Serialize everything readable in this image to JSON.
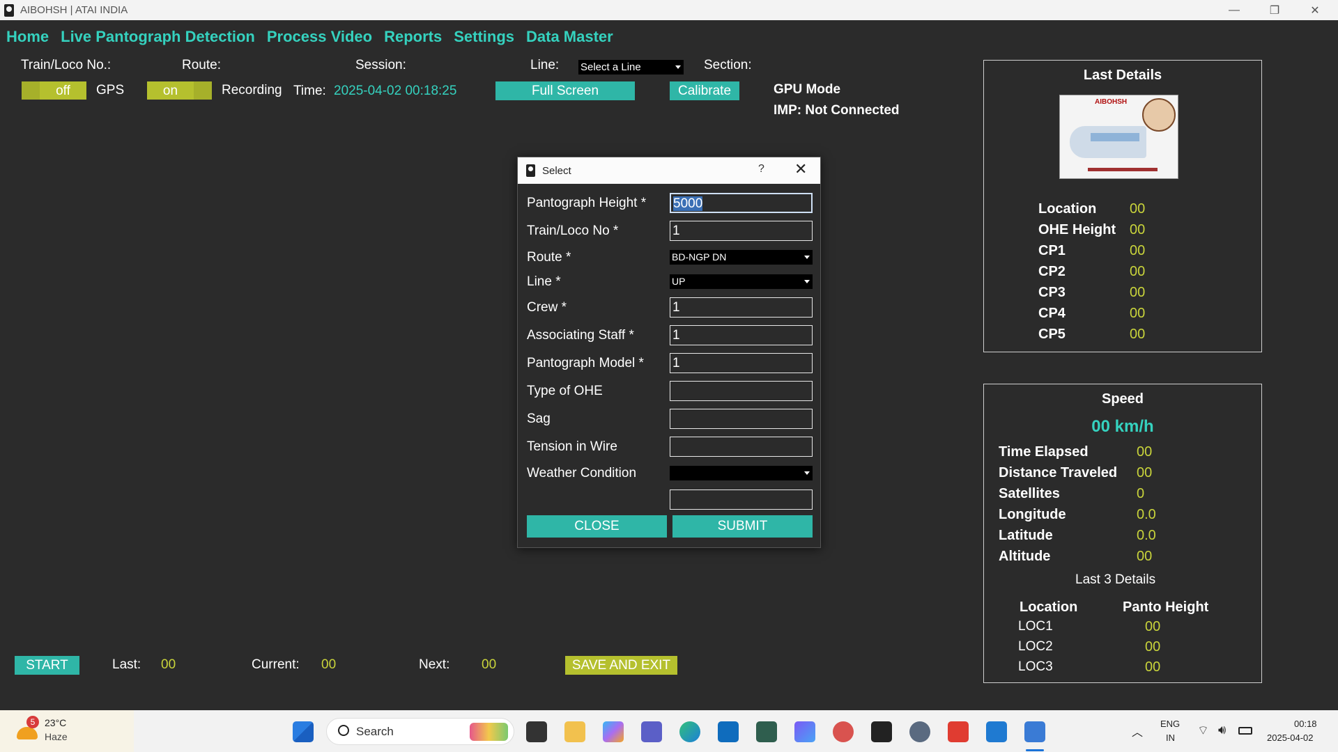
{
  "window": {
    "title": "AIBOHSH | ATAI INDIA",
    "minimize": "—",
    "restore": "❐",
    "close": "✕"
  },
  "menu": [
    "Home",
    "Live Pantograph Detection",
    "Process Video",
    "Reports",
    "Settings",
    "Data Master"
  ],
  "header": {
    "train_loco_label": "Train/Loco No.:",
    "route_label": "Route:",
    "session_label": "Session:",
    "line_label": "Line:",
    "line_select": "Select a Line",
    "section_label": "Section:",
    "gps_toggle": "off",
    "gps_label": "GPS",
    "recording_toggle": "on",
    "recording_label": "Recording",
    "time_label": "Time:",
    "time_value": "2025-04-02 00:18:25",
    "fullscreen_button": "Full Screen",
    "calibrate_button": "Calibrate",
    "gpu_mode": "GPU Mode",
    "imp_status": "IMP: Not Connected"
  },
  "last_details": {
    "title": "Last Details",
    "logo_text": "AIBOHSH",
    "rows": [
      {
        "label": "Location",
        "value": "00"
      },
      {
        "label": "OHE Height",
        "value": "00"
      },
      {
        "label": "CP1",
        "value": "00"
      },
      {
        "label": "CP2",
        "value": "00"
      },
      {
        "label": "CP3",
        "value": "00"
      },
      {
        "label": "CP4",
        "value": "00"
      },
      {
        "label": "CP5",
        "value": "00"
      }
    ]
  },
  "speed": {
    "title": "Speed",
    "value": "00 km/h",
    "rows": [
      {
        "label": "Time Elapsed",
        "value": "00"
      },
      {
        "label": "Distance Traveled",
        "value": "00"
      },
      {
        "label": "Satellites",
        "value": "0"
      },
      {
        "label": "Longitude",
        "value": "0.0"
      },
      {
        "label": "Latitude",
        "value": "0.0"
      },
      {
        "label": "Altitude",
        "value": "00"
      }
    ],
    "last3_title": "Last 3 Details",
    "col_location": "Location",
    "col_height": "Panto Height",
    "last3": [
      {
        "loc": "LOC1",
        "height": "00"
      },
      {
        "loc": "LOC2",
        "height": "00"
      },
      {
        "loc": "LOC3",
        "height": "00"
      }
    ]
  },
  "dialog": {
    "title": "Select",
    "help": "?",
    "close_x": "✕",
    "fields": {
      "pantograph_height": {
        "label": "Pantograph Height *",
        "value": "5000"
      },
      "train_loco": {
        "label": "Train/Loco No *",
        "value": "1"
      },
      "route": {
        "label": "Route *",
        "value": "BD-NGP DN"
      },
      "line": {
        "label": "Line *",
        "value": "UP"
      },
      "crew": {
        "label": "Crew *",
        "value": "1"
      },
      "associating_staff": {
        "label": "Associating Staff *",
        "value": "1"
      },
      "pantograph_model": {
        "label": "Pantograph Model *",
        "value": "1"
      },
      "type_of_ohe": {
        "label": "Type of OHE",
        "value": ""
      },
      "sag": {
        "label": "Sag",
        "value": ""
      },
      "tension": {
        "label": "Tension in Wire",
        "value": ""
      },
      "weather": {
        "label": "Weather Condition",
        "value": ""
      },
      "extra": {
        "label": "",
        "value": ""
      }
    },
    "close_button": "CLOSE",
    "submit_button": "SUBMIT"
  },
  "bottom": {
    "start_button": "START",
    "last_label": "Last:",
    "last_value": "00",
    "current_label": "Current:",
    "current_value": "00",
    "next_label": "Next:",
    "next_value": "00",
    "save_exit_button": "SAVE AND EXIT"
  },
  "taskbar": {
    "weather_badge": "5",
    "temperature": "23°C",
    "condition": "Haze",
    "search": "Search",
    "lang1": "ENG",
    "lang2": "IN",
    "time": "00:18",
    "date": "2025-04-02"
  },
  "colors": {
    "teal": "#35d2bf",
    "yellow": "#c9d43b",
    "button_teal": "#2fb6a7",
    "button_olive": "#b5c02e",
    "background": "#2b2b2b"
  }
}
